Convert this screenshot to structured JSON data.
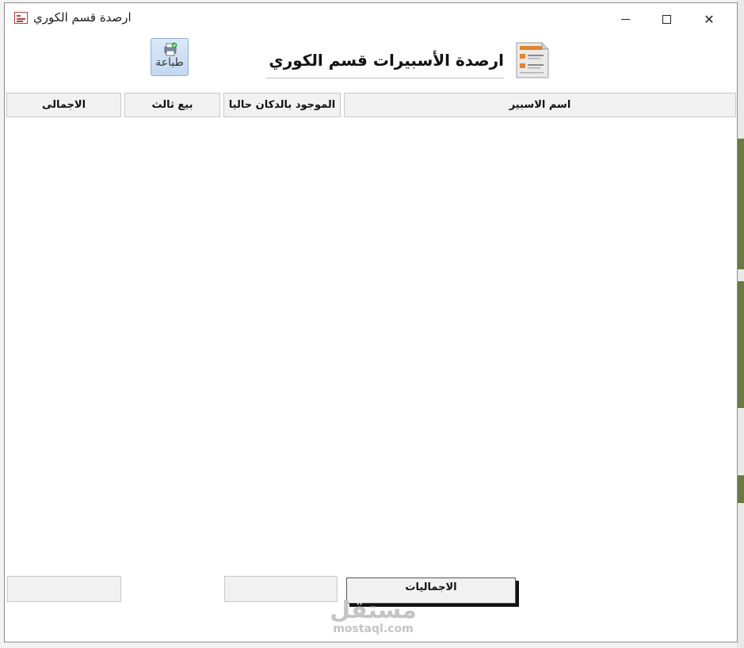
{
  "window": {
    "title": "ارصدة قسم الكوري",
    "minimize_symbol": "",
    "close_symbol": "✕"
  },
  "toolbar": {
    "print_label": "طباعة"
  },
  "report": {
    "title": "ارصدة  الأسبيرات قسم الكوري"
  },
  "table": {
    "columns": [
      "الاجمالى",
      "بيع ثالث",
      "الموجود بالدكان حاليا",
      "اسم الاسبير"
    ],
    "rows": []
  },
  "footer": {
    "totals_label": "الاجماليات",
    "total_sum_value": "",
    "stock_sum_value": ""
  },
  "watermark": {
    "arabic": "مستقل",
    "latin": "mostaql.com"
  },
  "colors": {
    "header_bg": "#f1f1f1",
    "print_button_bg": "#c3d8f0",
    "title_icon_accent": "#b5413c",
    "background_app_green": "#6b7a44"
  }
}
